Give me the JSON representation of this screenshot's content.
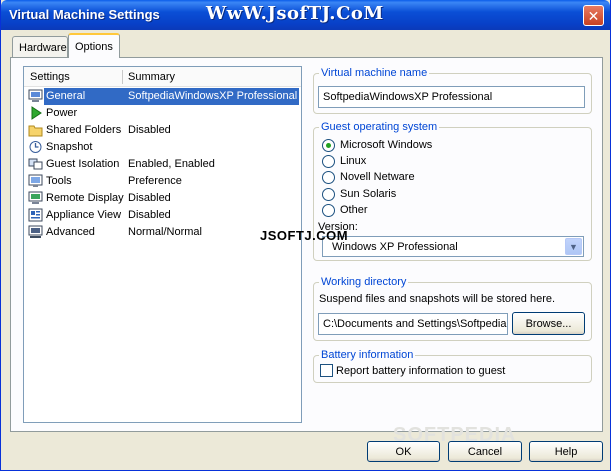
{
  "window": {
    "title": "Virtual Machine Settings",
    "watermark": "WwW.JsofTJ.CoM",
    "close_glyph": "✕"
  },
  "tabs": [
    {
      "label": "Hardware",
      "active": false
    },
    {
      "label": "Options",
      "active": true
    }
  ],
  "settings_list": {
    "columns": [
      "Settings",
      "Summary"
    ],
    "items": [
      {
        "label": "General",
        "summary": "SoftpediaWindowsXP Professional",
        "icon": "general-icon",
        "selected": true
      },
      {
        "label": "Power",
        "summary": "",
        "icon": "power-icon",
        "selected": false
      },
      {
        "label": "Shared Folders",
        "summary": "Disabled",
        "icon": "folder-icon",
        "selected": false
      },
      {
        "label": "Snapshot",
        "summary": "",
        "icon": "snapshot-icon",
        "selected": false
      },
      {
        "label": "Guest Isolation",
        "summary": "Enabled, Enabled",
        "icon": "guest-isolation-icon",
        "selected": false
      },
      {
        "label": "Tools",
        "summary": "Preference",
        "icon": "tools-icon",
        "selected": false
      },
      {
        "label": "Remote Display",
        "summary": "Disabled",
        "icon": "remote-display-icon",
        "selected": false
      },
      {
        "label": "Appliance View",
        "summary": "Disabled",
        "icon": "appliance-view-icon",
        "selected": false
      },
      {
        "label": "Advanced",
        "summary": "Normal/Normal",
        "icon": "advanced-icon",
        "selected": false
      }
    ]
  },
  "vm_name": {
    "title": "Virtual machine name",
    "value": "SoftpediaWindowsXP Professional"
  },
  "guest_os": {
    "title": "Guest operating system",
    "options": [
      "Microsoft Windows",
      "Linux",
      "Novell Netware",
      "Sun Solaris",
      "Other"
    ],
    "selected_index": 0,
    "version_label": "Version:",
    "version_value": "Windows XP Professional"
  },
  "working_dir": {
    "title": "Working directory",
    "description": "Suspend files and snapshots will be stored here.",
    "path": "C:\\Documents and Settings\\Softpedia",
    "browse_label": "Browse..."
  },
  "battery": {
    "title": "Battery information",
    "checkbox_label": "Report battery information to guest",
    "checked": false
  },
  "overlay_watermarks": {
    "center": "JSOFTJ.COM",
    "softpedia": "SOFTPEDIA"
  },
  "footer": {
    "ok_label": "OK",
    "cancel_label": "Cancel",
    "help_label": "Help"
  },
  "colors": {
    "titlebar": "#0a4fd6",
    "selection": "#316ac5",
    "group_title": "#0046d5"
  }
}
